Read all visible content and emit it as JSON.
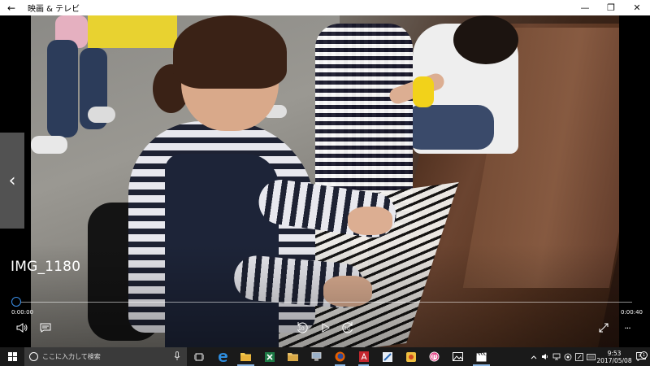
{
  "window": {
    "title": "映画 & テレビ",
    "back_glyph": "←",
    "minimize_glyph": "—",
    "maximize_glyph": "❐",
    "close_glyph": "✕"
  },
  "player": {
    "video_title": "IMG_1180",
    "current_time": "0:00:00",
    "end_time": "0:00:40",
    "progress_fraction": 0.0,
    "skip_back_label": "10",
    "skip_forward_label": "30",
    "prev_glyph": "‹",
    "more_glyph": "···"
  },
  "taskbar": {
    "search_placeholder": "ここに入力して検索",
    "apps": [
      {
        "name": "task-view"
      },
      {
        "name": "edge"
      },
      {
        "name": "file-explorer"
      },
      {
        "name": "excel"
      },
      {
        "name": "folder"
      },
      {
        "name": "this-pc"
      },
      {
        "name": "firefox"
      },
      {
        "name": "acrobat"
      },
      {
        "name": "app-a"
      },
      {
        "name": "app-b"
      },
      {
        "name": "itunes"
      },
      {
        "name": "photos"
      },
      {
        "name": "movies-tv"
      }
    ],
    "clock_time": "9:53",
    "clock_date": "2017/05/08",
    "notification_count": "1",
    "colors": {
      "accent": "#3b8fe8",
      "taskbar": "#1a1a1a",
      "search_box": "#3a3a3a",
      "excel": "#1d7a45",
      "edge": "#2e8ee0",
      "acrobat": "#c4262e",
      "firefox": "#e66000"
    }
  }
}
